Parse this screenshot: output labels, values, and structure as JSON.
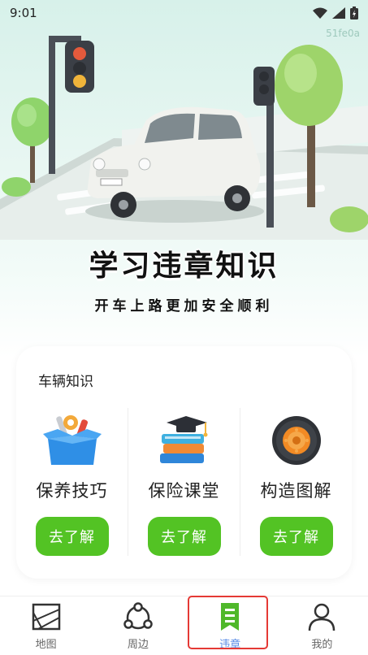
{
  "status_bar": {
    "time": "9:01"
  },
  "watermark": "51fe0a",
  "hero": {
    "title": "学习违章知识",
    "subtitle": "开车上路更加安全顺利"
  },
  "card": {
    "title": "车辆知识",
    "items": [
      {
        "label": "保养技巧",
        "button": "去了解",
        "icon": "toolbox-icon"
      },
      {
        "label": "保险课堂",
        "button": "去了解",
        "icon": "books-icon"
      },
      {
        "label": "构造图解",
        "button": "去了解",
        "icon": "tire-icon"
      }
    ]
  },
  "nav": {
    "items": [
      {
        "label": "地图",
        "icon": "map-icon"
      },
      {
        "label": "周边",
        "icon": "nearby-icon"
      },
      {
        "label": "违章",
        "icon": "violation-icon",
        "active": true
      },
      {
        "label": "我的",
        "icon": "profile-icon"
      }
    ]
  },
  "colors": {
    "accent": "#53c324",
    "nav_active": "#5b8ee6",
    "highlight": "#e53935"
  }
}
